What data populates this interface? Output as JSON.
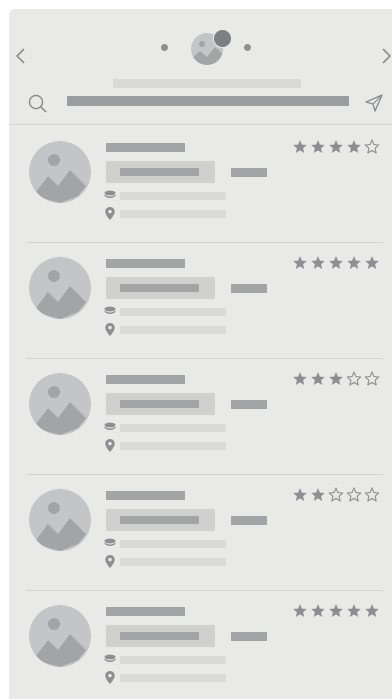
{
  "colors": {
    "card_bg": "#e9eae8",
    "placeholder_dark": "#a3a4a6",
    "placeholder_light": "#dadbd9",
    "icon": "#8d8e91"
  },
  "header": {
    "prev_icon": "chevron-left-icon",
    "next_icon": "chevron-right-icon",
    "avatar_icon": "image-placeholder-icon",
    "search_icon": "search-icon",
    "send_icon": "send-icon"
  },
  "items": [
    {
      "rating": 4,
      "max_rating": 5
    },
    {
      "rating": 5,
      "max_rating": 5
    },
    {
      "rating": 3,
      "max_rating": 5
    },
    {
      "rating": 2,
      "max_rating": 5
    },
    {
      "rating": 5,
      "max_rating": 5
    }
  ]
}
